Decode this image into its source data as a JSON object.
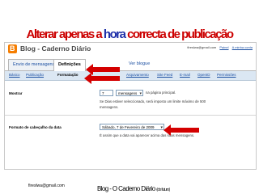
{
  "slide": {
    "title_pre": "Alterar apenas a ",
    "title_highlight": "hora",
    "title_post": " correcta de publicação",
    "footer_email": "fireslwa@gmail.com",
    "footer_title": "Blog - O Caderno Diário ",
    "footer_note": "(do futuro)"
  },
  "blogger": {
    "account_email": "fireslwa@gmail.com",
    "header_links": [
      "Painel",
      "A minha conta"
    ],
    "blog_name": "Blog - Caderno Diário",
    "tabs": [
      "Envio de mensagens",
      "Definições",
      "Ver blogue"
    ],
    "active_tab": "Definições",
    "subnav": [
      "Básico",
      "Publicação",
      "Formatação",
      "Arquivamento",
      "Site Feed",
      "E-mail",
      "OpenID",
      "Permissões"
    ],
    "active_subnav": "Formatação",
    "mostrar": {
      "label": "Mostrar",
      "count_value": "7",
      "unit_value": "mensagens",
      "suffix": "na página principal.",
      "help_line1": "Se Dias estiver seleccionado, será imposto um limite máximo de 500",
      "help_line2": "mensagens."
    },
    "date_format": {
      "label": "Formato de cabeçalho da data",
      "value": "Sábado, 7 de Fevereiro de 2009",
      "help": "É assim que a data vai aparecer acima das suas mensagens."
    }
  },
  "colors": {
    "arrow": "#d40000",
    "title_red": "#cc0000",
    "title_blue": "#1e2fa8"
  }
}
